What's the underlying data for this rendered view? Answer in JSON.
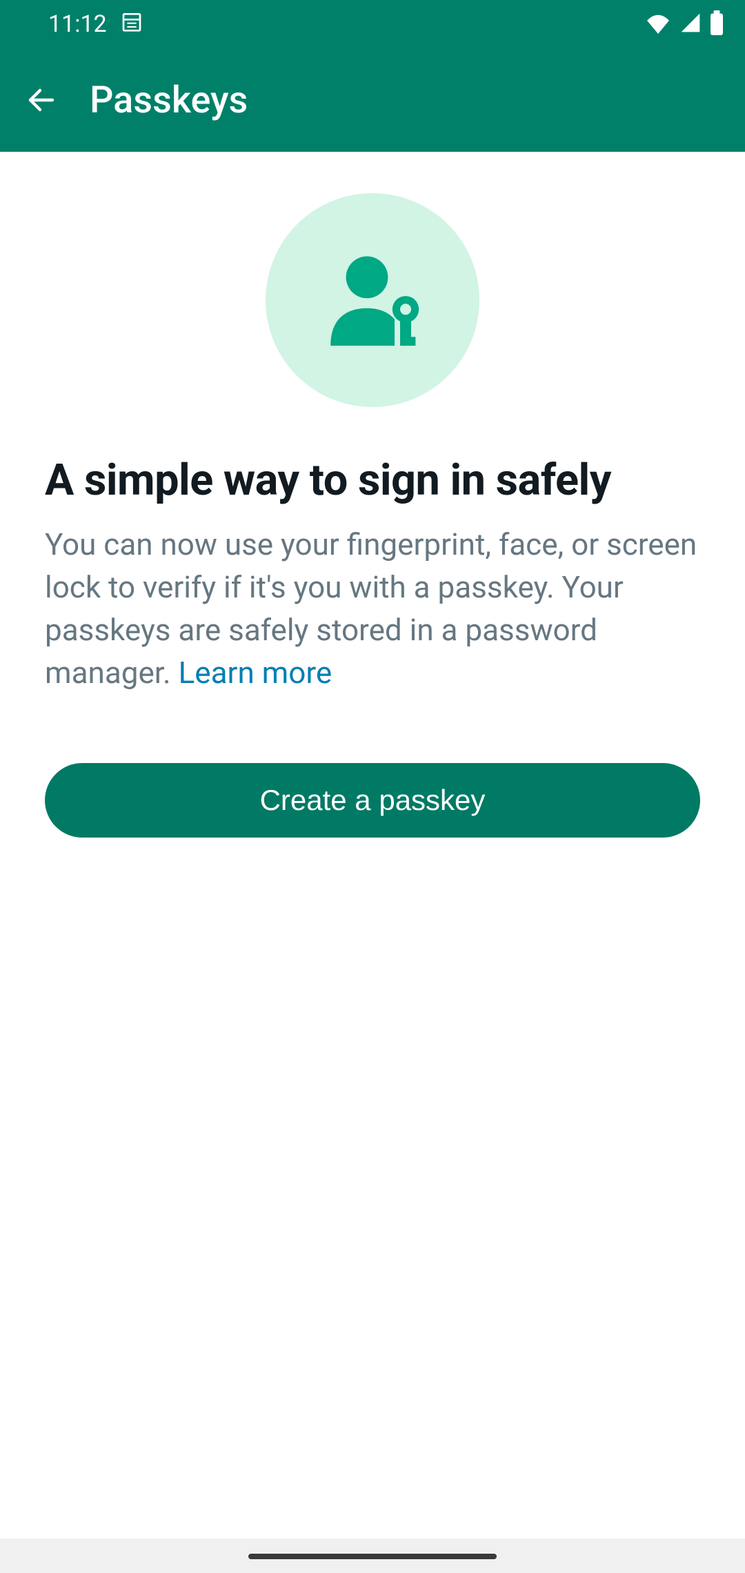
{
  "status": {
    "time": "11:12"
  },
  "appbar": {
    "title": "Passkeys"
  },
  "content": {
    "headline": "A simple way to sign in safely",
    "description": "You can now use your fingerprint, face, or screen lock to verify if it's you with a passkey. Your passkeys are safely stored in a password manager. ",
    "learn_more": "Learn more",
    "primary_button": "Create a passkey"
  }
}
